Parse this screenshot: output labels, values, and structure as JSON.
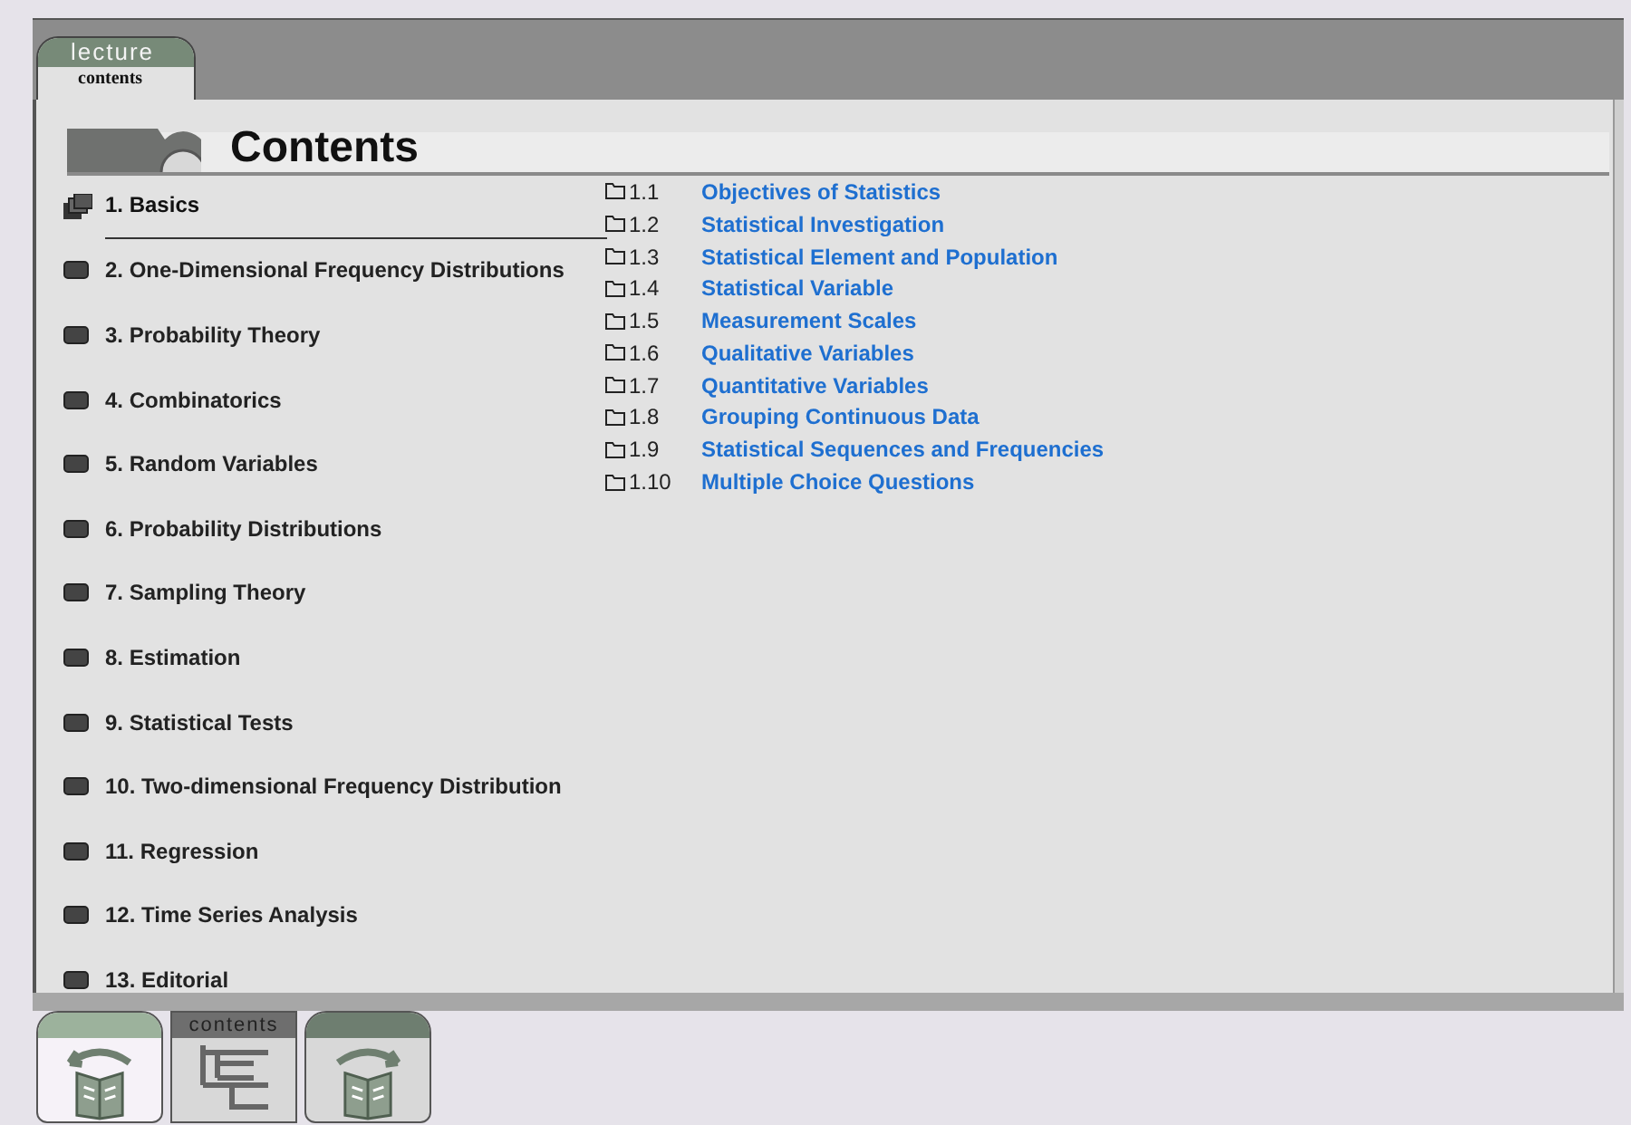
{
  "tab": {
    "title": "lecture",
    "subtitle": "contents"
  },
  "heading": "Contents",
  "chapters": [
    {
      "label": "1. Basics",
      "selected": true
    },
    {
      "label": "2. One-Dimensional Frequency Distributions",
      "selected": false
    },
    {
      "label": "3. Probability Theory",
      "selected": false
    },
    {
      "label": "4. Combinatorics",
      "selected": false
    },
    {
      "label": "5. Random Variables",
      "selected": false
    },
    {
      "label": "6. Probability Distributions",
      "selected": false
    },
    {
      "label": "7. Sampling Theory",
      "selected": false
    },
    {
      "label": "8. Estimation",
      "selected": false
    },
    {
      "label": "9. Statistical Tests",
      "selected": false
    },
    {
      "label": "10. Two-dimensional Frequency Distribution",
      "selected": false
    },
    {
      "label": "11. Regression",
      "selected": false
    },
    {
      "label": "12. Time Series Analysis",
      "selected": false
    },
    {
      "label": "13. Editorial",
      "selected": false
    }
  ],
  "sections": [
    {
      "number": "1.1",
      "title": "Objectives of Statistics"
    },
    {
      "number": "1.2",
      "title": "Statistical Investigation"
    },
    {
      "number": "1.3",
      "title": "Statistical Element and Population"
    },
    {
      "number": "1.4",
      "title": "Statistical Variable"
    },
    {
      "number": "1.5",
      "title": "Measurement Scales"
    },
    {
      "number": "1.6",
      "title": "Qualitative Variables"
    },
    {
      "number": "1.7",
      "title": "Quantitative Variables"
    },
    {
      "number": "1.8",
      "title": "Grouping Continuous Data"
    },
    {
      "number": "1.9",
      "title": "Statistical Sequences and Frequencies"
    },
    {
      "number": "1.10",
      "title": "Multiple Choice Questions"
    }
  ],
  "nav": [
    {
      "kind": "back"
    },
    {
      "kind": "contents",
      "label": "contents"
    },
    {
      "kind": "forward"
    }
  ]
}
